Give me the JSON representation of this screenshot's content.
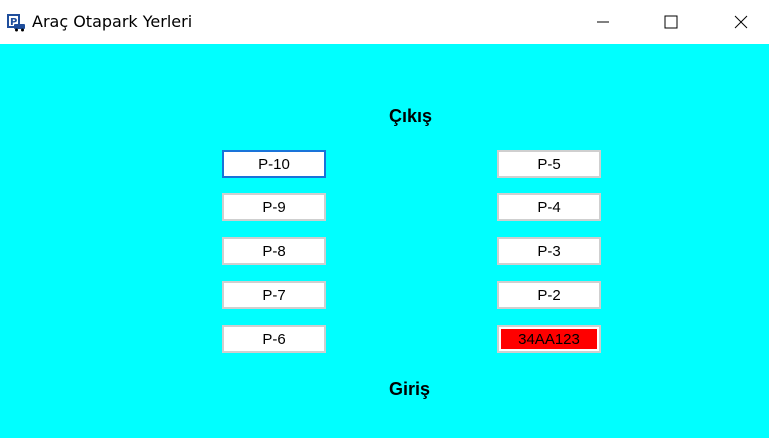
{
  "window": {
    "title": "Araç Otapark Yerleri",
    "background": "#00FFFF"
  },
  "labels": {
    "exit": "Çıkış",
    "entry": "Giriş"
  },
  "slots": {
    "left": [
      {
        "label": "P-10",
        "focused": true
      },
      {
        "label": "P-9"
      },
      {
        "label": "P-8"
      },
      {
        "label": "P-7"
      },
      {
        "label": "P-6"
      }
    ],
    "right": [
      {
        "label": "P-5"
      },
      {
        "label": "P-4"
      },
      {
        "label": "P-3"
      },
      {
        "label": "P-2"
      },
      {
        "label": "34AA123",
        "occupied": true,
        "color": "#FF0000"
      }
    ]
  }
}
